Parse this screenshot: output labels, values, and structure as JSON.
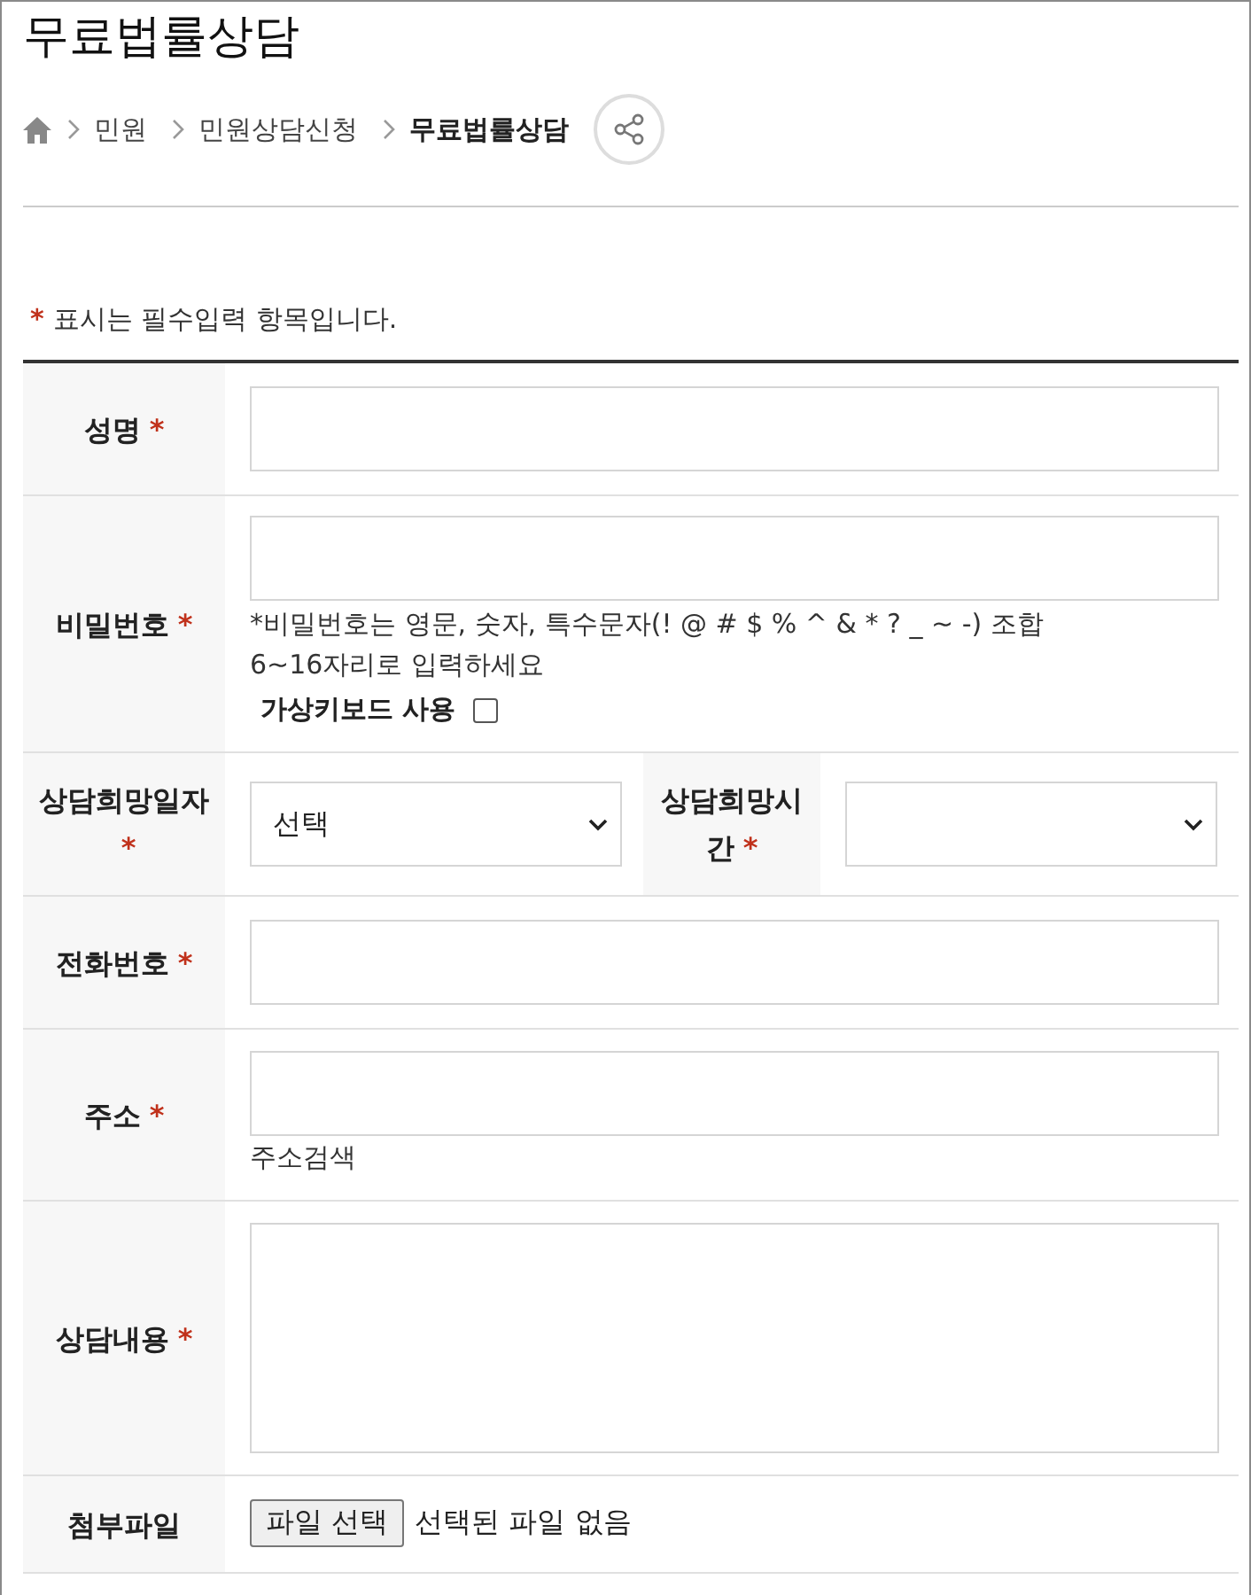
{
  "page_title": "무료법률상담",
  "breadcrumb": {
    "items": [
      {
        "label": "민원",
        "current": false
      },
      {
        "label": "민원상담신청",
        "current": false
      },
      {
        "label": "무료법률상담",
        "current": true
      }
    ]
  },
  "required_note": {
    "mark": "*",
    "text": "표시는 필수입력 항목입니다."
  },
  "fields": [
    {
      "kind": "text",
      "label": "성명",
      "mark": "*"
    },
    {
      "kind": "password",
      "label": "비밀번호",
      "mark": "*",
      "hint": "*비밀번호는 영문, 숫자, 특수문자(! @ # $ % ^ & * ? _ ~ -) 조합 6~16자리로 입력하세요",
      "virtual_keyboard": {
        "label": "가상키보드 사용",
        "checked": false
      }
    },
    {
      "kind": "select_pair",
      "label": "상담희망일자",
      "mark": "*",
      "value": "선택",
      "second": {
        "label": "상담희망시간",
        "mark": "*"
      }
    },
    {
      "kind": "text",
      "label": "전화번호",
      "mark": "*"
    },
    {
      "kind": "address",
      "label": "주소",
      "mark": "*",
      "link": "주소검색"
    },
    {
      "kind": "textarea",
      "label": "상담내용",
      "mark": "*"
    },
    {
      "kind": "file",
      "label": "첨부파일",
      "button": "파일 선택",
      "status": "선택된 파일 없음"
    }
  ]
}
